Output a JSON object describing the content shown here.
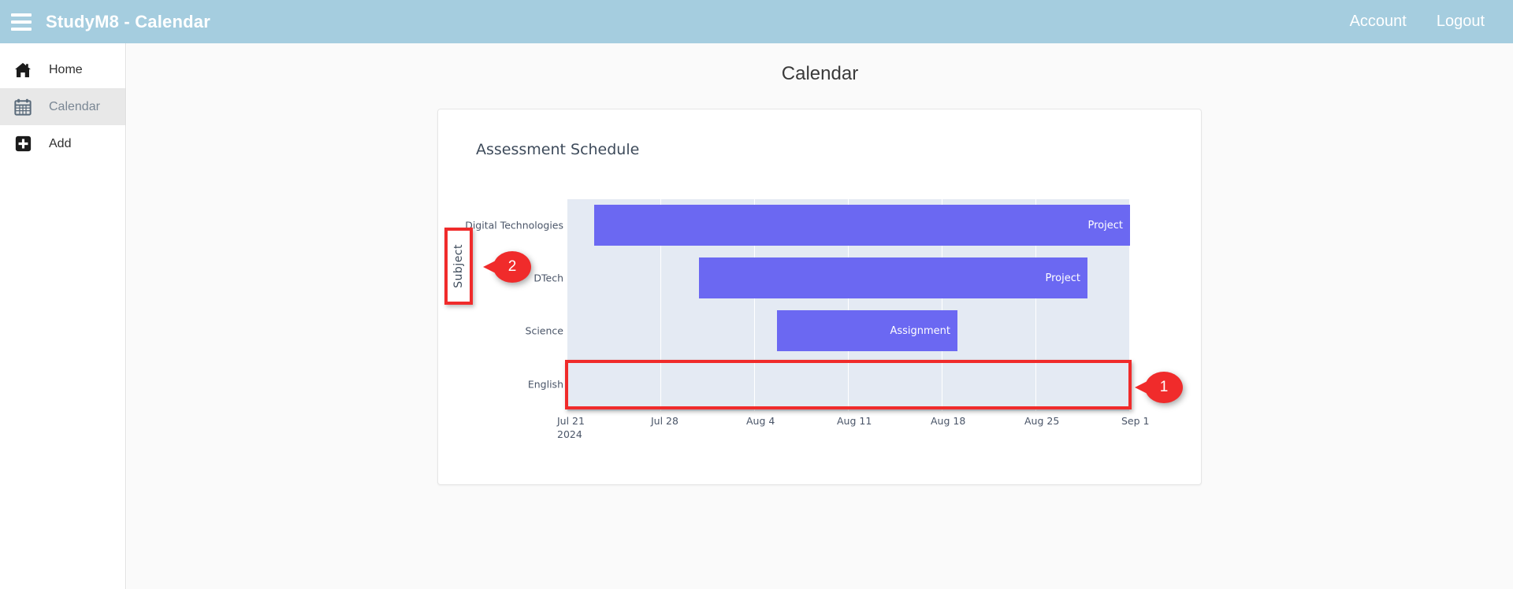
{
  "navbar": {
    "brand": "StudyM8 - Calendar",
    "menu_icon": "hamburger-icon",
    "links": [
      {
        "label": "Account"
      },
      {
        "label": "Logout"
      }
    ]
  },
  "sidebar": {
    "items": [
      {
        "label": "Home",
        "icon": "home-icon",
        "active": false
      },
      {
        "label": "Calendar",
        "icon": "calendar-icon",
        "active": true
      },
      {
        "label": "Add",
        "icon": "plus-square-icon",
        "active": false
      }
    ]
  },
  "main": {
    "page_title": "Calendar"
  },
  "chart_data": {
    "type": "bar",
    "title": "Assessment Schedule",
    "xlabel": "",
    "ylabel": "Subject",
    "categories": [
      "Digital Technologies",
      "DTech",
      "Science",
      "English"
    ],
    "x_tick_labels": [
      "Jul 21",
      "Jul 28",
      "Aug 4",
      "Aug 11",
      "Aug 18",
      "Aug 25",
      "Sep 1"
    ],
    "x_axis_year": "2024",
    "xlim": [
      "2024-07-21",
      "2024-09-01"
    ],
    "grid": true,
    "legend": "none",
    "bar_color": "#6B68F2",
    "plot_background": "#E4EAF3",
    "bars": [
      {
        "category": "Digital Technologies",
        "label": "Project",
        "start": "2024-07-23",
        "end": "2024-09-01",
        "start_frac": 0.049,
        "end_frac": 1.0
      },
      {
        "category": "DTech",
        "label": "Project",
        "start": "2024-07-31",
        "end": "2024-08-28",
        "start_frac": 0.235,
        "end_frac": 0.924
      },
      {
        "category": "Science",
        "label": "Assignment",
        "start": "2024-08-05",
        "end": "2024-08-14",
        "start_frac": 0.374,
        "end_frac": 0.694
      },
      {
        "category": "English",
        "label": "",
        "start": "",
        "end": "",
        "start_frac": 0,
        "end_frac": 0
      }
    ]
  },
  "annotations": [
    {
      "number": "1",
      "target": "english-row-empty-area"
    },
    {
      "number": "2",
      "target": "subject-axis-title"
    }
  ],
  "colors": {
    "navbar": "#A5CDDF",
    "bar": "#6B68F2",
    "plot_bg": "#E4EAF3",
    "annotation": "#F02B2B",
    "active_sidebar": "#E8E8E8"
  }
}
